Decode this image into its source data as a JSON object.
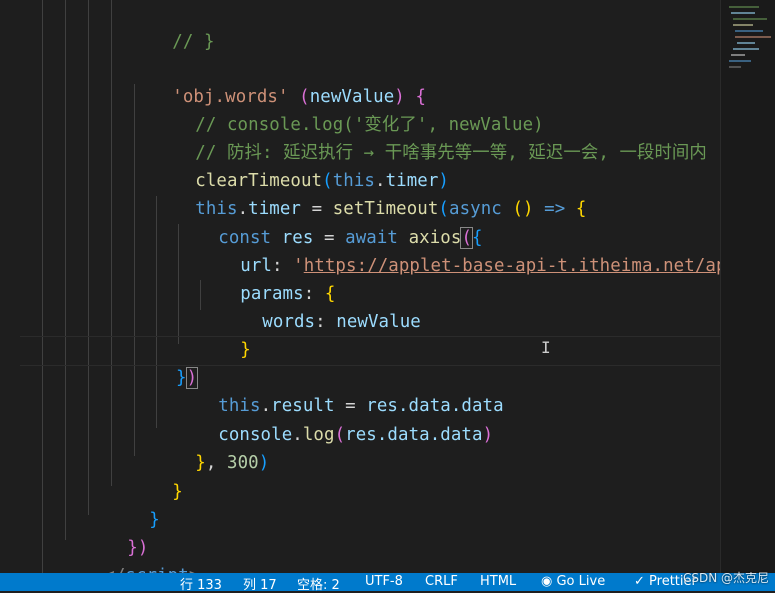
{
  "code": {
    "l1": "// }",
    "l2_key": "'obj.words'",
    "l2_param": "newValue",
    "l3_comment": "// console.log('变化了', newValue)",
    "l4_comment": "// 防抖: 延迟执行 → 干啥事先等一等, 延迟一会, 一段时间内",
    "l5_fn": "clearTimeout",
    "l5_this": "this",
    "l5_prop": "timer",
    "l6_this": "this",
    "l6_prop": "timer",
    "l6_fn": "setTimeout",
    "l6_async": "async",
    "l7_const": "const",
    "l7_var": "res",
    "l7_await": "await",
    "l7_fn": "axios",
    "l8_key": "url",
    "l8_url": "https://applet-base-api-t.itheima.net/ap",
    "l9_key": "params",
    "l10_key": "words",
    "l10_val": "newValue",
    "l13_this": "this",
    "l13_prop": "result",
    "l13_val": "res.data.data",
    "l14_obj": "console",
    "l14_fn": "log",
    "l14_arg": "res.data.data",
    "l15_num": "300",
    "l19_tag": "script"
  },
  "status": {
    "line": "行 133",
    "col": "列 17",
    "spaces": "空格: 2",
    "encoding": "UTF-8",
    "eol": "CRLF",
    "language": "HTML",
    "golive": "Go Live",
    "prettier": "Prettier"
  },
  "watermark": "CSDN @杰克尼"
}
